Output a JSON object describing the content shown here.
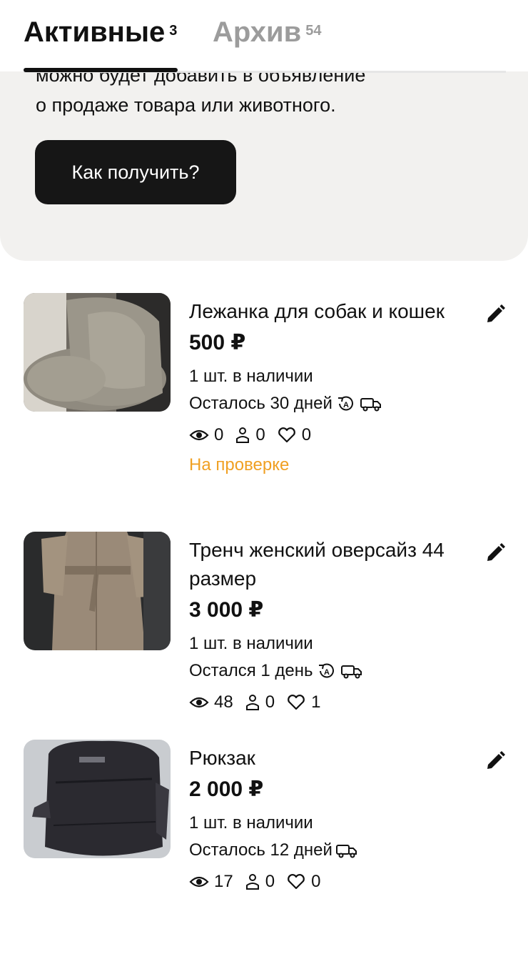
{
  "tabs": {
    "active": {
      "label": "Активные",
      "count": "3"
    },
    "archive": {
      "label": "Архив",
      "count": "54"
    }
  },
  "promo": {
    "line1": "можно будет добавить в объявление",
    "line2": "о продаже товара или животного.",
    "button_label": "Как получить?"
  },
  "listings": [
    {
      "title": "Лежанка для собак и кошек",
      "price": "500 ₽",
      "stock": "1 шт. в наличии",
      "remaining": "Осталось 30 дней",
      "views": "0",
      "contacts": "0",
      "favorites": "0",
      "status": "На проверке",
      "icons": [
        "auto-renew-icon",
        "delivery-truck-icon"
      ]
    },
    {
      "title": "Тренч женский оверсайз 44 размер",
      "price": "3 000 ₽",
      "stock": "1 шт. в наличии",
      "remaining": "Остался 1 день",
      "views": "48",
      "contacts": "0",
      "favorites": "1",
      "icons": [
        "auto-renew-icon",
        "delivery-truck-icon"
      ]
    },
    {
      "title": "Рюкзак",
      "price": "2 000 ₽",
      "stock": "1 шт. в наличии",
      "remaining": "Осталось 12 дней",
      "views": "17",
      "contacts": "0",
      "favorites": "0",
      "icons": [
        "delivery-truck-icon"
      ]
    }
  ],
  "colors": {
    "status_review": "#f0a023",
    "button_bg": "#161616",
    "promo_bg": "#f2f1ef",
    "tab_inactive": "#9c9c9c"
  }
}
